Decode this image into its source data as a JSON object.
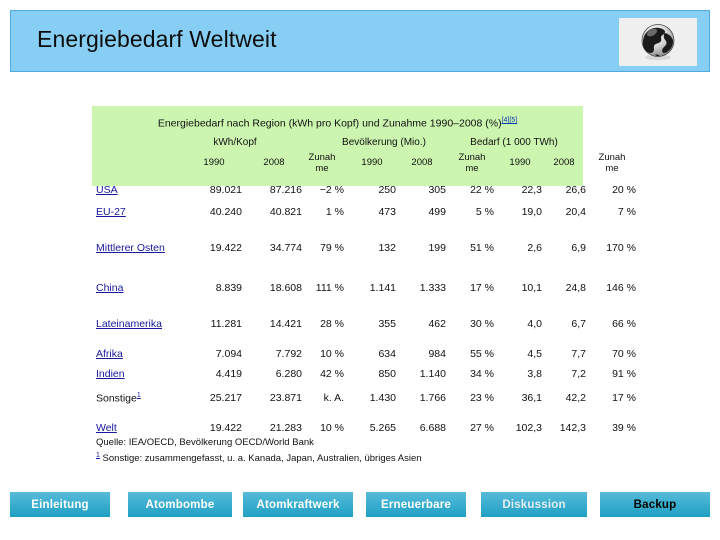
{
  "slide": {
    "title": "Energiebedarf Weltweit",
    "logo_icon": "globe-icon"
  },
  "table": {
    "caption": "Energiebedarf nach Region (kWh pro Kopf) und Zunahme 1990–2008 (%)",
    "caption_refs": "[4][5]",
    "group_headers": [
      "kWh/Kopf",
      "Bevölkerung (Mio.)",
      "Bedarf (1 000 TWh)"
    ],
    "sub_headers": [
      "1990",
      "2008",
      "Zunah\nme",
      "1990",
      "2008",
      "Zunah\nme",
      "1990",
      "2008",
      "Zunah\nme"
    ],
    "sub_headers_flat": [
      "1990",
      "2008",
      "Zunahme",
      "1990",
      "2008",
      "Zunahme",
      "1990",
      "2008",
      "Zunahme"
    ],
    "rows": [
      {
        "region": "USA",
        "link": true,
        "note": "",
        "values": [
          "89.021",
          "87.216",
          "−2 %",
          "250",
          "305",
          "22 %",
          "22,3",
          "26,6",
          "20 %"
        ]
      },
      {
        "region": "EU-27",
        "link": true,
        "note": "",
        "values": [
          "40.240",
          "40.821",
          "1 %",
          "473",
          "499",
          "5 %",
          "19,0",
          "20,4",
          "7 %"
        ]
      },
      {
        "region": "Mittlerer Osten",
        "link": true,
        "note": "",
        "values": [
          "19.422",
          "34.774",
          "79 %",
          "132",
          "199",
          "51 %",
          "2,6",
          "6,9",
          "170 %"
        ]
      },
      {
        "region": "China",
        "link": true,
        "note": "",
        "values": [
          "8.839",
          "18.608",
          "111 %",
          "1.141",
          "1.333",
          "17 %",
          "10,1",
          "24,8",
          "146 %"
        ]
      },
      {
        "region": "Lateinamerika",
        "link": true,
        "note": "",
        "values": [
          "11.281",
          "14.421",
          "28 %",
          "355",
          "462",
          "30 %",
          "4,0",
          "6,7",
          "66 %"
        ]
      },
      {
        "region": "Afrika",
        "link": true,
        "note": "",
        "values": [
          "7.094",
          "7.792",
          "10 %",
          "634",
          "984",
          "55 %",
          "4,5",
          "7,7",
          "70 %"
        ]
      },
      {
        "region": "Indien",
        "link": true,
        "note": "",
        "values": [
          "4.419",
          "6.280",
          "42 %",
          "850",
          "1.140",
          "34 %",
          "3,8",
          "7,2",
          "91 %"
        ]
      },
      {
        "region": "Sonstige",
        "link": false,
        "note": "1",
        "values": [
          "25.217",
          "23.871",
          "k. A.",
          "1.430",
          "1.766",
          "23 %",
          "36,1",
          "42,2",
          "17 %"
        ]
      },
      {
        "region": "Welt",
        "link": true,
        "note": "",
        "values": [
          "19.422",
          "21.283",
          "10 %",
          "5.265",
          "6.688",
          "27 %",
          "102,3",
          "142,3",
          "39 %"
        ]
      }
    ],
    "source_line": "Quelle: IEA/OECD, Bevölkerung OECD/World Bank",
    "footnote_mark": "1",
    "footnote_text": "Sonstige: zusammengefasst, u. a. Kanada, Japan, Australien, übriges Asien"
  },
  "nav": {
    "buttons": [
      {
        "label": "Einleitung",
        "style": "normal"
      },
      {
        "label": "Atombombe",
        "style": "normal"
      },
      {
        "label": "Atomkraftwerk",
        "style": "normal"
      },
      {
        "label": "Erneuerbare",
        "style": "normal"
      },
      {
        "label": "Diskussion",
        "style": "dim"
      },
      {
        "label": "Backup",
        "style": "dark"
      }
    ]
  },
  "colors": {
    "title_bar": "#87CEF5",
    "title_border": "#4FA9DE",
    "table_header": "#CCF5B0",
    "link": "#16189e",
    "nav_button": "#3DAFD0"
  }
}
